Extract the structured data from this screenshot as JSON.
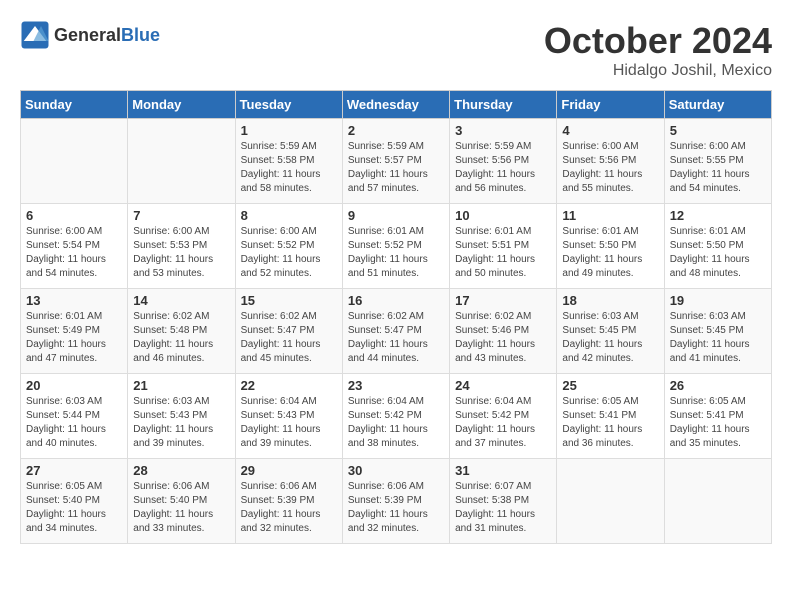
{
  "logo": {
    "general": "General",
    "blue": "Blue"
  },
  "title": "October 2024",
  "location": "Hidalgo Joshil, Mexico",
  "days_of_week": [
    "Sunday",
    "Monday",
    "Tuesday",
    "Wednesday",
    "Thursday",
    "Friday",
    "Saturday"
  ],
  "weeks": [
    [
      {
        "day": "",
        "info": ""
      },
      {
        "day": "",
        "info": ""
      },
      {
        "day": "1",
        "info": "Sunrise: 5:59 AM\nSunset: 5:58 PM\nDaylight: 11 hours and 58 minutes."
      },
      {
        "day": "2",
        "info": "Sunrise: 5:59 AM\nSunset: 5:57 PM\nDaylight: 11 hours and 57 minutes."
      },
      {
        "day": "3",
        "info": "Sunrise: 5:59 AM\nSunset: 5:56 PM\nDaylight: 11 hours and 56 minutes."
      },
      {
        "day": "4",
        "info": "Sunrise: 6:00 AM\nSunset: 5:56 PM\nDaylight: 11 hours and 55 minutes."
      },
      {
        "day": "5",
        "info": "Sunrise: 6:00 AM\nSunset: 5:55 PM\nDaylight: 11 hours and 54 minutes."
      }
    ],
    [
      {
        "day": "6",
        "info": "Sunrise: 6:00 AM\nSunset: 5:54 PM\nDaylight: 11 hours and 54 minutes."
      },
      {
        "day": "7",
        "info": "Sunrise: 6:00 AM\nSunset: 5:53 PM\nDaylight: 11 hours and 53 minutes."
      },
      {
        "day": "8",
        "info": "Sunrise: 6:00 AM\nSunset: 5:52 PM\nDaylight: 11 hours and 52 minutes."
      },
      {
        "day": "9",
        "info": "Sunrise: 6:01 AM\nSunset: 5:52 PM\nDaylight: 11 hours and 51 minutes."
      },
      {
        "day": "10",
        "info": "Sunrise: 6:01 AM\nSunset: 5:51 PM\nDaylight: 11 hours and 50 minutes."
      },
      {
        "day": "11",
        "info": "Sunrise: 6:01 AM\nSunset: 5:50 PM\nDaylight: 11 hours and 49 minutes."
      },
      {
        "day": "12",
        "info": "Sunrise: 6:01 AM\nSunset: 5:50 PM\nDaylight: 11 hours and 48 minutes."
      }
    ],
    [
      {
        "day": "13",
        "info": "Sunrise: 6:01 AM\nSunset: 5:49 PM\nDaylight: 11 hours and 47 minutes."
      },
      {
        "day": "14",
        "info": "Sunrise: 6:02 AM\nSunset: 5:48 PM\nDaylight: 11 hours and 46 minutes."
      },
      {
        "day": "15",
        "info": "Sunrise: 6:02 AM\nSunset: 5:47 PM\nDaylight: 11 hours and 45 minutes."
      },
      {
        "day": "16",
        "info": "Sunrise: 6:02 AM\nSunset: 5:47 PM\nDaylight: 11 hours and 44 minutes."
      },
      {
        "day": "17",
        "info": "Sunrise: 6:02 AM\nSunset: 5:46 PM\nDaylight: 11 hours and 43 minutes."
      },
      {
        "day": "18",
        "info": "Sunrise: 6:03 AM\nSunset: 5:45 PM\nDaylight: 11 hours and 42 minutes."
      },
      {
        "day": "19",
        "info": "Sunrise: 6:03 AM\nSunset: 5:45 PM\nDaylight: 11 hours and 41 minutes."
      }
    ],
    [
      {
        "day": "20",
        "info": "Sunrise: 6:03 AM\nSunset: 5:44 PM\nDaylight: 11 hours and 40 minutes."
      },
      {
        "day": "21",
        "info": "Sunrise: 6:03 AM\nSunset: 5:43 PM\nDaylight: 11 hours and 39 minutes."
      },
      {
        "day": "22",
        "info": "Sunrise: 6:04 AM\nSunset: 5:43 PM\nDaylight: 11 hours and 39 minutes."
      },
      {
        "day": "23",
        "info": "Sunrise: 6:04 AM\nSunset: 5:42 PM\nDaylight: 11 hours and 38 minutes."
      },
      {
        "day": "24",
        "info": "Sunrise: 6:04 AM\nSunset: 5:42 PM\nDaylight: 11 hours and 37 minutes."
      },
      {
        "day": "25",
        "info": "Sunrise: 6:05 AM\nSunset: 5:41 PM\nDaylight: 11 hours and 36 minutes."
      },
      {
        "day": "26",
        "info": "Sunrise: 6:05 AM\nSunset: 5:41 PM\nDaylight: 11 hours and 35 minutes."
      }
    ],
    [
      {
        "day": "27",
        "info": "Sunrise: 6:05 AM\nSunset: 5:40 PM\nDaylight: 11 hours and 34 minutes."
      },
      {
        "day": "28",
        "info": "Sunrise: 6:06 AM\nSunset: 5:40 PM\nDaylight: 11 hours and 33 minutes."
      },
      {
        "day": "29",
        "info": "Sunrise: 6:06 AM\nSunset: 5:39 PM\nDaylight: 11 hours and 32 minutes."
      },
      {
        "day": "30",
        "info": "Sunrise: 6:06 AM\nSunset: 5:39 PM\nDaylight: 11 hours and 32 minutes."
      },
      {
        "day": "31",
        "info": "Sunrise: 6:07 AM\nSunset: 5:38 PM\nDaylight: 11 hours and 31 minutes."
      },
      {
        "day": "",
        "info": ""
      },
      {
        "day": "",
        "info": ""
      }
    ]
  ]
}
